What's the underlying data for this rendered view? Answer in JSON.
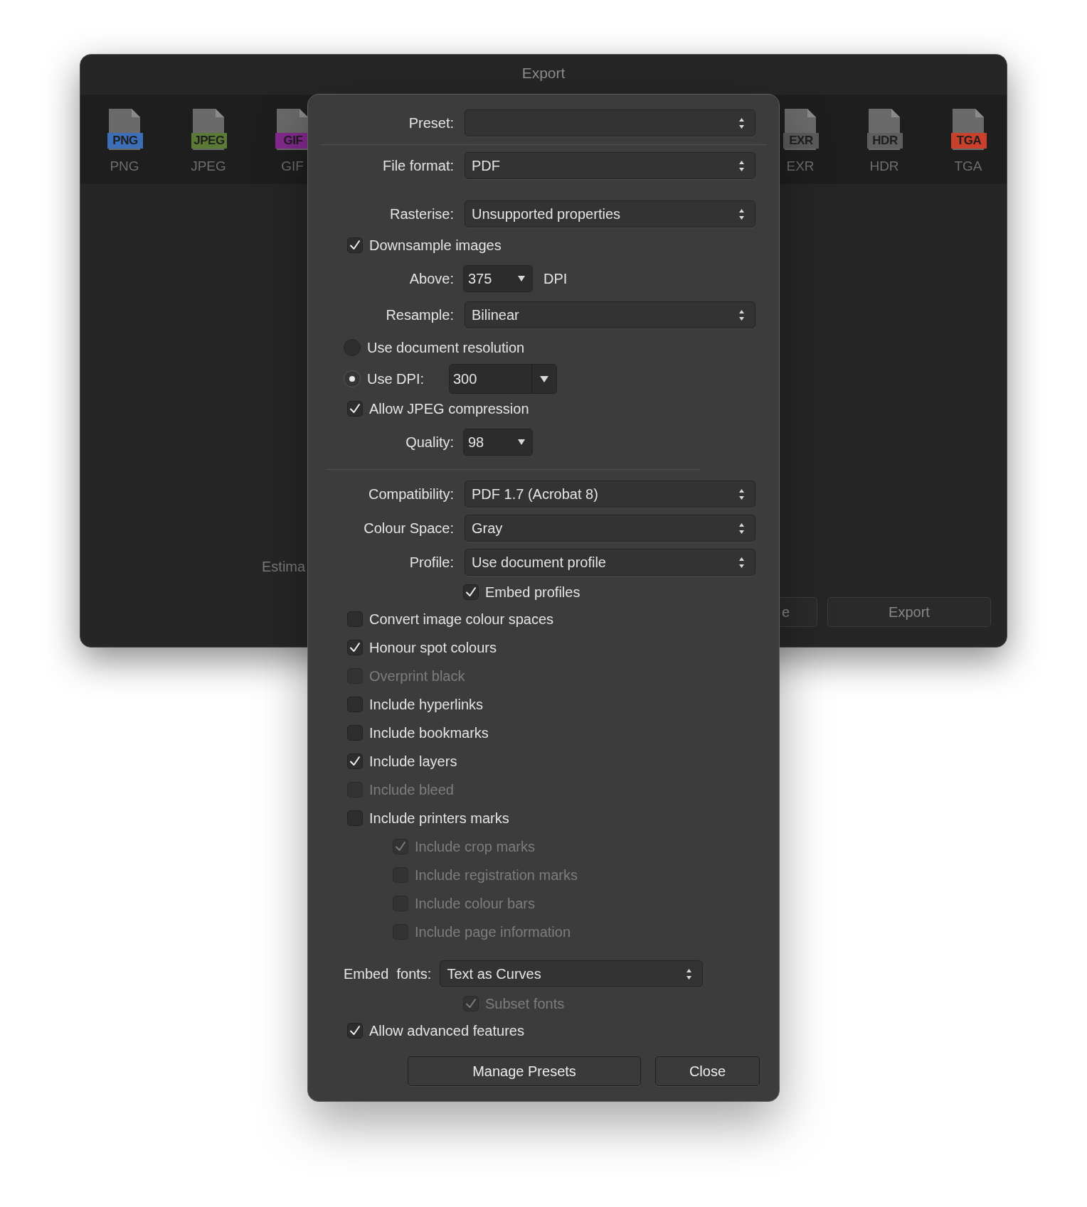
{
  "background_window": {
    "title": "Export",
    "formats_left": [
      {
        "label": "PNG",
        "badge": "PNG",
        "color": "#3d6fb8"
      },
      {
        "label": "JPEG",
        "badge": "JPEG",
        "color": "#5a7a35"
      },
      {
        "label": "GIF",
        "badge": "GIF",
        "color": "#84298f"
      }
    ],
    "formats_right": [
      {
        "label": "EXR",
        "badge": "EXR",
        "color": "#5b5b5b"
      },
      {
        "label": "HDR",
        "badge": "HDR",
        "color": "#5e5e5e"
      },
      {
        "label": "TGA",
        "badge": "TGA",
        "color": "#c9412c"
      }
    ],
    "estimate_label": "Estima",
    "buttons": [
      "e",
      "Export"
    ]
  },
  "dialog": {
    "rows": [
      {
        "kind": "popup",
        "label": "Preset:"
      },
      {
        "kind": "separator"
      },
      {
        "kind": "popup",
        "label": "File format:",
        "value": "PDF"
      },
      {
        "kind": "popup",
        "label": "Rasterise:",
        "value": "Unsupported properties"
      },
      {
        "kind": "check",
        "label": "Downsample images",
        "checked": true,
        "disabled": false
      },
      {
        "kind": "combo",
        "label": "Above:",
        "value": "375",
        "unit": "DPI"
      },
      {
        "kind": "popup",
        "label": "Resample:",
        "value": "Bilinear"
      },
      {
        "kind": "radio",
        "label": "Use document resolution",
        "selected": false
      },
      {
        "kind": "radio",
        "label": "Use DPI:",
        "selected": true,
        "field": "300"
      },
      {
        "kind": "check",
        "label": "Allow JPEG compression",
        "checked": true,
        "disabled": false
      },
      {
        "kind": "combo",
        "label": "Quality:",
        "value": "98"
      },
      {
        "kind": "separator"
      },
      {
        "kind": "popup",
        "label": "Compatibility:",
        "value": "PDF 1.7 (Acrobat 8)"
      },
      {
        "kind": "popup",
        "label": "Colour Space:",
        "value": "Gray"
      },
      {
        "kind": "popup",
        "label": "Profile:",
        "value": "Use document profile",
        "children": [
          {
            "kind": "check",
            "label": "Embed profiles",
            "checked": true,
            "disabled": false
          }
        ]
      },
      {
        "kind": "check",
        "label": "Convert image colour spaces",
        "checked": false,
        "disabled": false
      },
      {
        "kind": "check",
        "label": "Honour spot colours",
        "checked": true,
        "disabled": false
      },
      {
        "kind": "check",
        "label": "Overprint black",
        "checked": false,
        "disabled": true
      },
      {
        "kind": "check",
        "label": "Include hyperlinks",
        "checked": false,
        "disabled": false
      },
      {
        "kind": "check",
        "label": "Include bookmarks",
        "checked": false,
        "disabled": false
      },
      {
        "kind": "check",
        "label": "Include layers",
        "checked": true,
        "disabled": false
      },
      {
        "kind": "check",
        "label": "Include bleed",
        "checked": false,
        "disabled": true
      },
      {
        "kind": "check",
        "label": "Include printers marks",
        "checked": false,
        "disabled": false,
        "children": [
          {
            "kind": "check",
            "label": "Include crop marks",
            "checked": true,
            "disabled": true
          },
          {
            "kind": "check",
            "label": "Include registration marks",
            "checked": false,
            "disabled": true
          },
          {
            "kind": "check",
            "label": "Include colour bars",
            "checked": false,
            "disabled": true
          },
          {
            "kind": "check",
            "label": "Include page information",
            "checked": false,
            "disabled": true
          }
        ]
      },
      {
        "kind": "inline-popup",
        "label": "Embed  fonts:",
        "value": "Text as Curves",
        "children": [
          {
            "kind": "check",
            "label": "Subset fonts",
            "checked": true,
            "disabled": true
          }
        ]
      },
      {
        "kind": "check",
        "label": "Allow advanced features",
        "checked": true,
        "disabled": false
      }
    ],
    "buttons": [
      "Manage Presets",
      "Close"
    ]
  }
}
